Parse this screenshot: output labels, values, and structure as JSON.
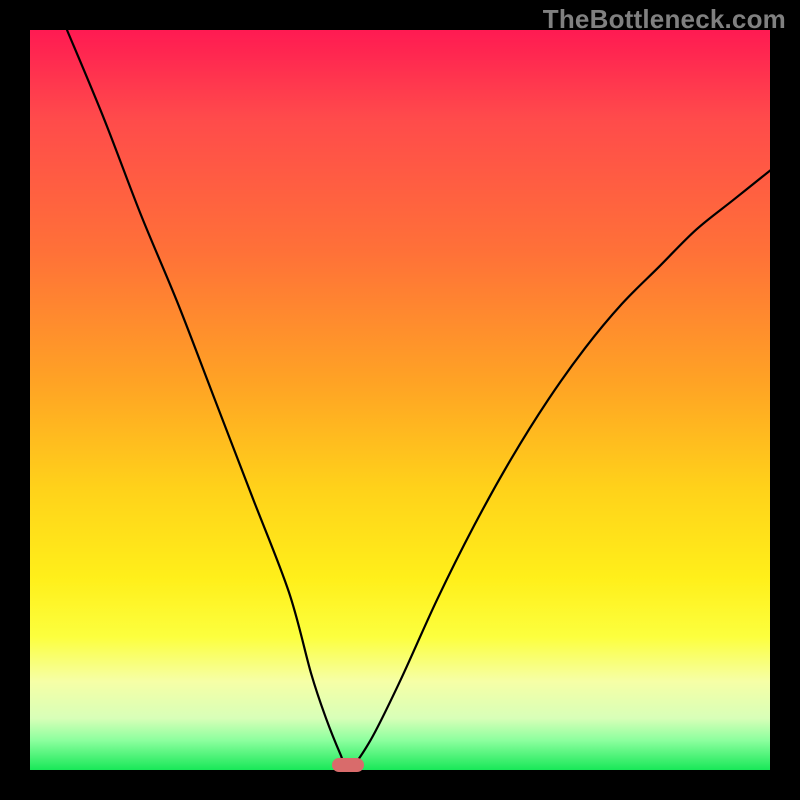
{
  "watermark": "TheBottleneck.com",
  "chart_data": {
    "type": "line",
    "title": "",
    "xlabel": "",
    "ylabel": "",
    "xlim": [
      0,
      100
    ],
    "ylim": [
      0,
      100
    ],
    "grid": false,
    "series": [
      {
        "name": "curve",
        "x": [
          5,
          10,
          15,
          20,
          25,
          30,
          35,
          38,
          40,
          42,
          43,
          46,
          50,
          55,
          60,
          65,
          70,
          75,
          80,
          85,
          90,
          95,
          100
        ],
        "y": [
          100,
          88,
          75,
          63,
          50,
          37,
          24,
          13,
          7,
          2,
          0,
          4,
          12,
          23,
          33,
          42,
          50,
          57,
          63,
          68,
          73,
          77,
          81
        ]
      }
    ],
    "marker": {
      "x_center": 43,
      "color": "#d96b6b"
    },
    "background_gradient": {
      "top": "#ff1a52",
      "bottom": "#18e858"
    }
  }
}
